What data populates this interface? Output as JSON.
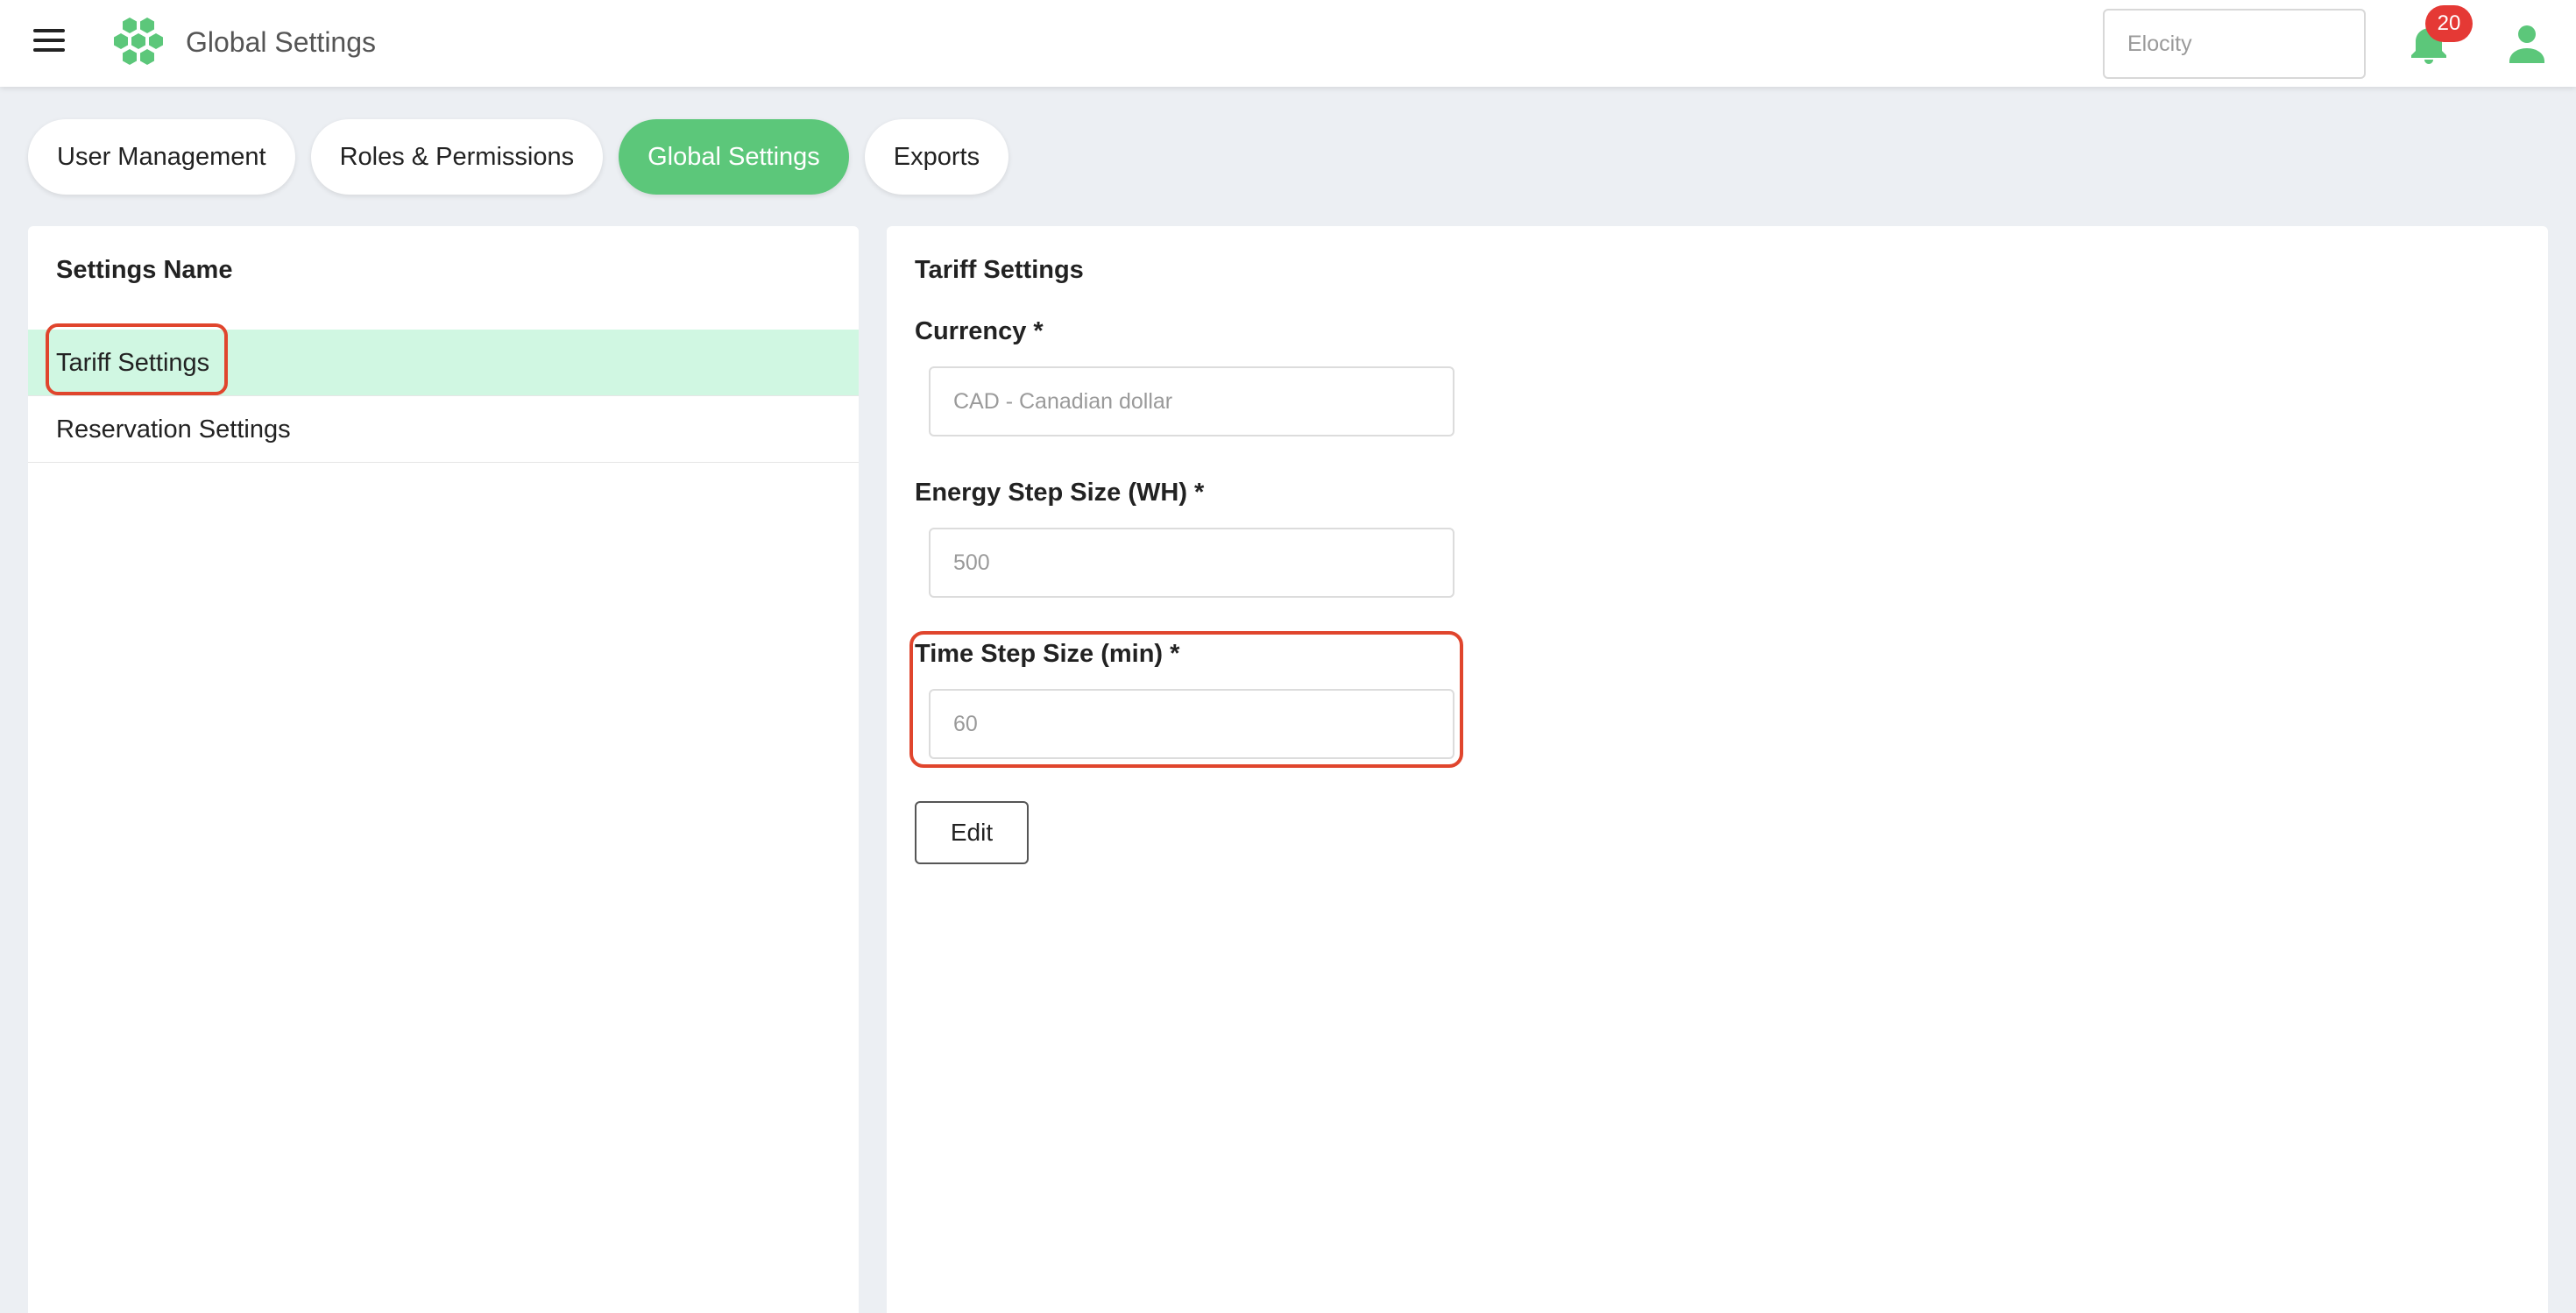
{
  "header": {
    "menu_icon": "hamburger-menu-icon",
    "logo_icon": "hexagon-cluster-logo",
    "title": "Global Settings",
    "org_selector_value": "Elocity",
    "notification_icon": "bell-icon",
    "notification_count": "20",
    "user_icon": "user-icon"
  },
  "tabs": [
    {
      "label": "User Management",
      "active": false
    },
    {
      "label": "Roles & Permissions",
      "active": false
    },
    {
      "label": "Global Settings",
      "active": true
    },
    {
      "label": "Exports",
      "active": false
    }
  ],
  "settings_list": {
    "title": "Settings Name",
    "items": [
      {
        "label": "Tariff Settings",
        "selected": true
      },
      {
        "label": "Reservation Settings",
        "selected": false
      }
    ]
  },
  "form": {
    "heading": "Tariff Settings",
    "fields": [
      {
        "label": "Currency *",
        "placeholder": "CAD - Canadian dollar"
      },
      {
        "label": "Energy Step Size (WH) *",
        "placeholder": "500"
      },
      {
        "label": "Time Step Size (min) *",
        "placeholder": "60"
      }
    ],
    "edit_label": "Edit"
  },
  "colors": {
    "accent": "#5cc77a",
    "selected_row": "#d0f7e2",
    "badge": "#e53935",
    "highlight": "#e0452d",
    "background": "#eceff3"
  }
}
